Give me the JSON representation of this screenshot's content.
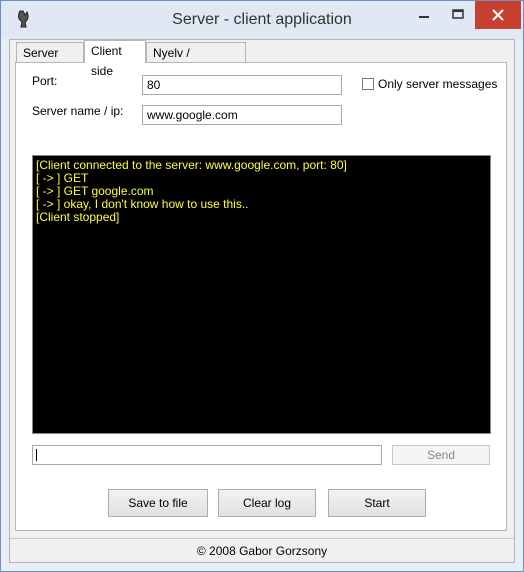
{
  "window": {
    "title": "Server - client application",
    "accent": "#c8402f"
  },
  "controls": {
    "minimize_icon": "minimize-icon",
    "maximize_icon": "maximize-icon",
    "close_icon": "close-icon"
  },
  "tabs": [
    {
      "label": "Server side",
      "active": false
    },
    {
      "label": "Client side",
      "active": true
    },
    {
      "label": "Nyelv / Language",
      "active": false
    }
  ],
  "form": {
    "port_label": "Port:",
    "port_value": "80",
    "server_label": "Server name / ip:",
    "server_value": "www.google.com",
    "only_server_messages_label": "Only server messages",
    "only_server_messages_checked": false
  },
  "log": {
    "lines": [
      "[Client connected to the server: www.google.com, port: 80]",
      "[ -> ] GET",
      "[ -> ] GET google.com",
      "[ -> ] okay, I don't know how to use this..",
      "[Client stopped]"
    ],
    "text_color": "#ffff33",
    "background": "#000000"
  },
  "message": {
    "value": "",
    "send_label": "Send",
    "send_enabled": false
  },
  "buttons": {
    "save_to_file": "Save to file",
    "clear_log": "Clear log",
    "start": "Start"
  },
  "status": {
    "copyright": "© 2008 Gabor Gorzsony"
  }
}
